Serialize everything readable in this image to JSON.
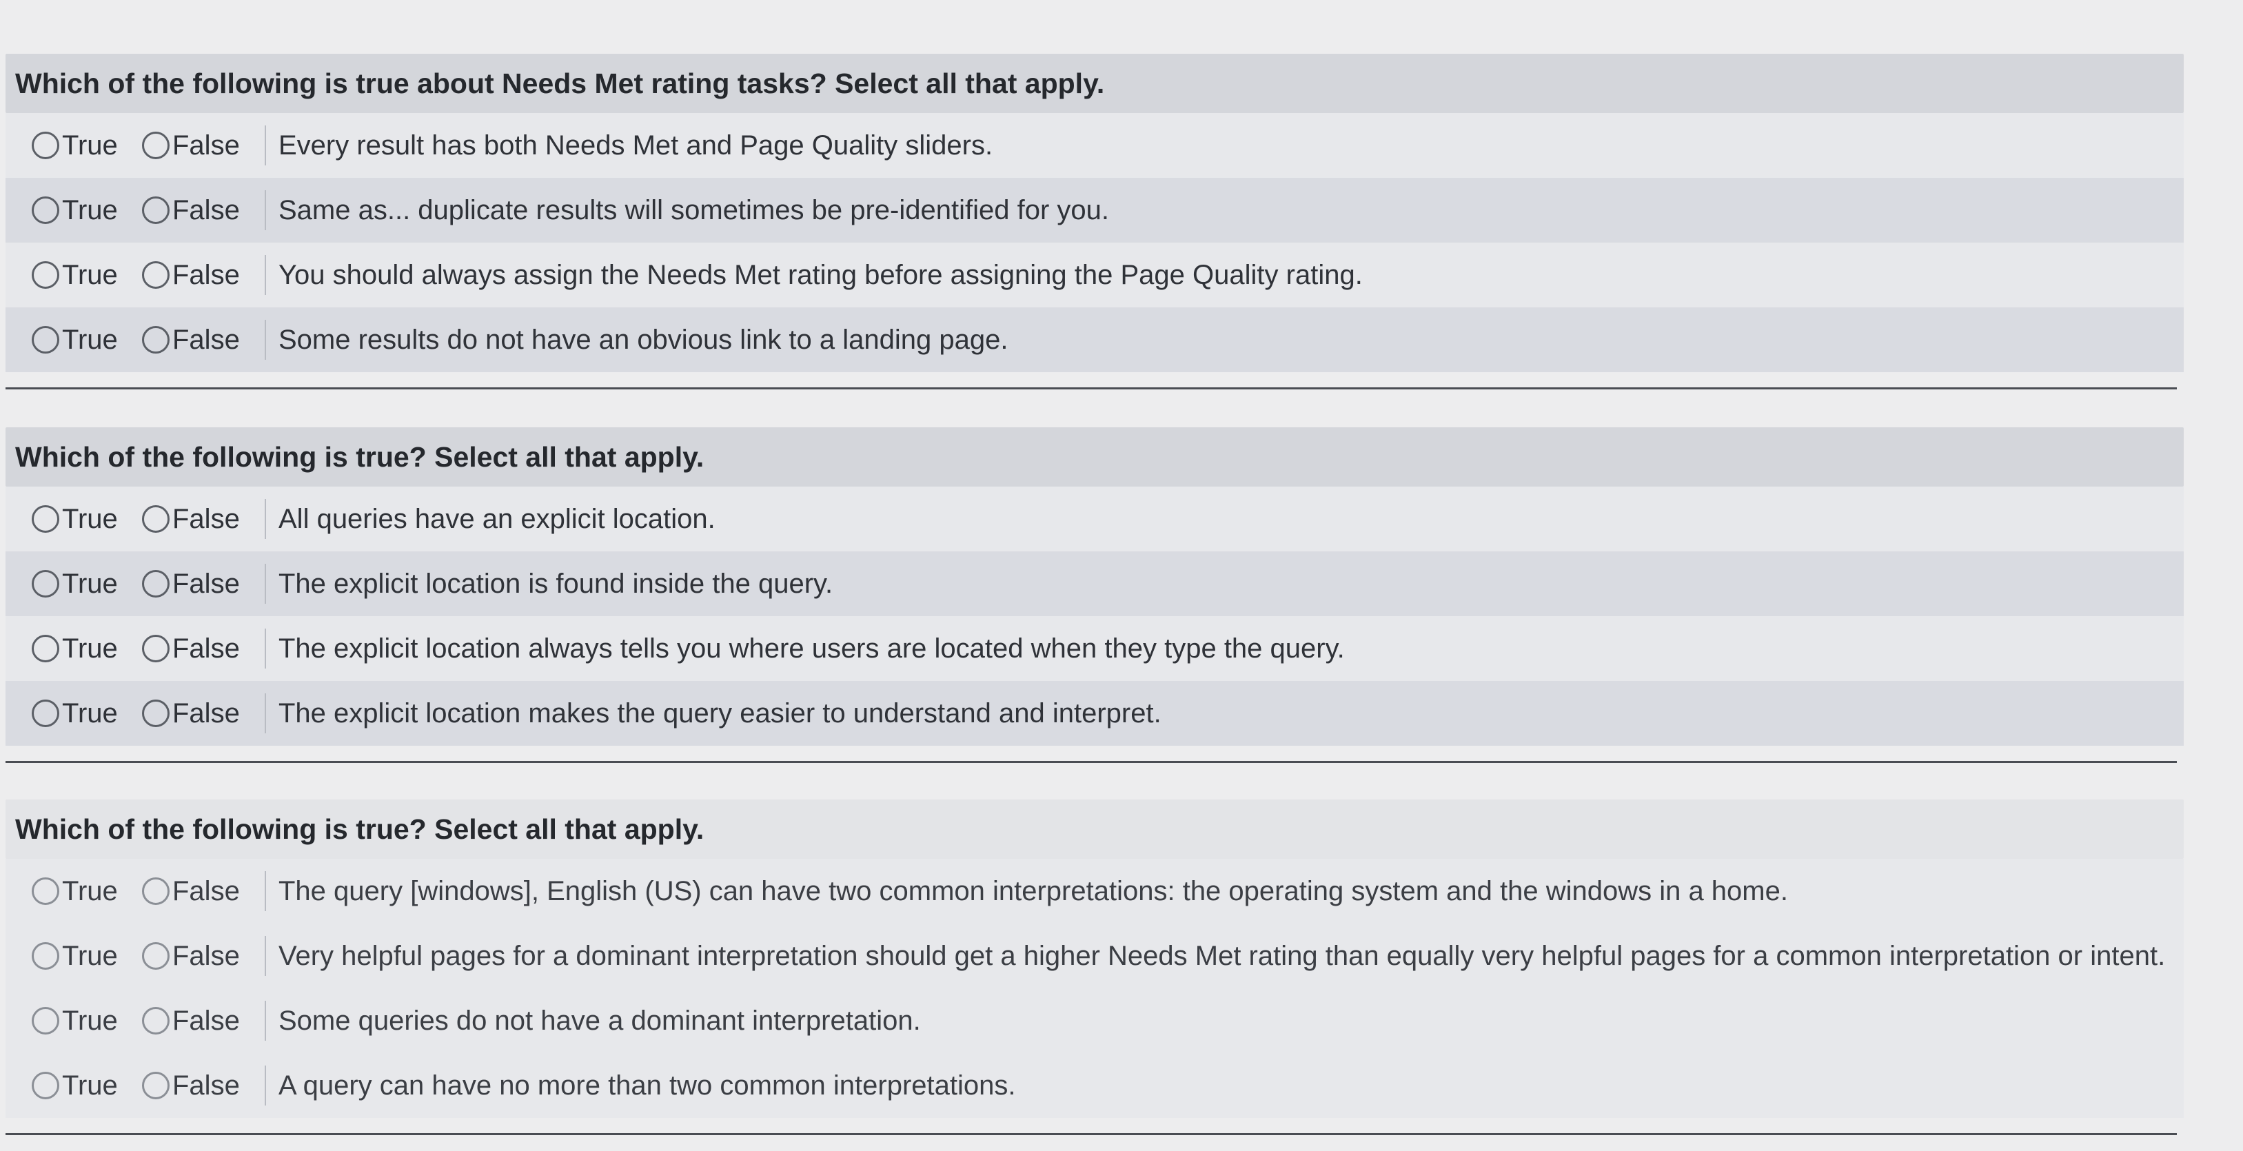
{
  "questions": [
    {
      "title": "Which of the following is true about Needs Met rating tasks? Select all that apply.",
      "true_label": "True",
      "false_label": "False",
      "statements": [
        "Every result has both Needs Met and Page Quality sliders.",
        "Same as... duplicate results will sometimes be pre-identified for you.",
        "You should always assign the Needs Met rating before assigning the Page Quality rating.",
        "Some results do not have an obvious link to a landing page."
      ]
    },
    {
      "title": "Which of the following is true? Select all that apply.",
      "true_label": "True",
      "false_label": "False",
      "statements": [
        "All queries have an explicit location.",
        "The explicit location is found inside the query.",
        "The explicit location always tells you where users are located when they type the query.",
        "The explicit location makes the query easier to understand and interpret."
      ]
    },
    {
      "title": "Which of the following is true? Select all that apply.",
      "true_label": "True",
      "false_label": "False",
      "statements": [
        "The query [windows], English (US) can have two common interpretations: the operating system and the windows in a home.",
        "Very helpful pages for a dominant interpretation should get a higher Needs Met rating than equally very helpful pages for a common interpretation or intent.",
        "Some queries do not have a dominant interpretation.",
        "A query can have no more than two common interpretations."
      ]
    }
  ]
}
